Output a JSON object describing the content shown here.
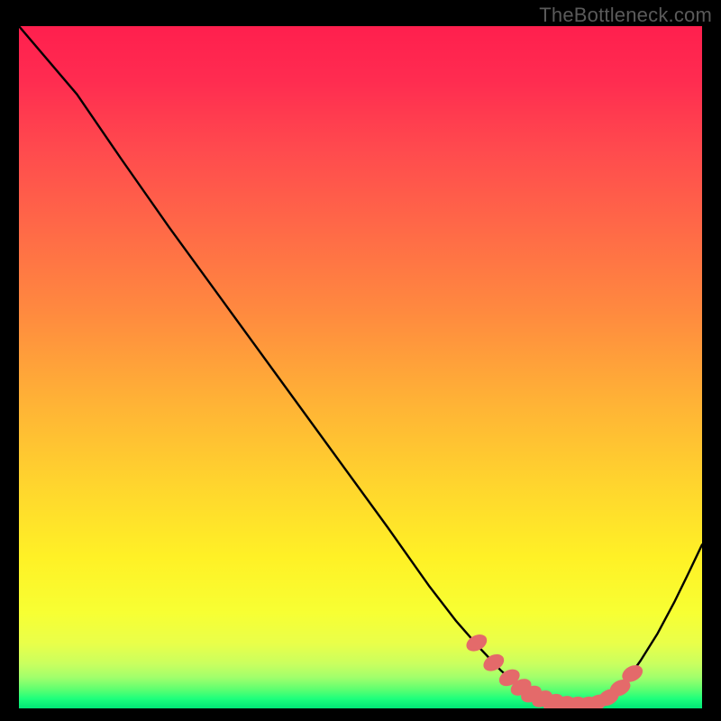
{
  "watermark": "TheBottleneck.com",
  "colors": {
    "frame": "#000000",
    "curve": "#000000",
    "marker_fill": "#e46a6a",
    "gradient_stops": [
      {
        "offset": 0.0,
        "color": "#ff1f4e"
      },
      {
        "offset": 0.08,
        "color": "#ff2c50"
      },
      {
        "offset": 0.18,
        "color": "#ff4a4e"
      },
      {
        "offset": 0.3,
        "color": "#ff6a47"
      },
      {
        "offset": 0.42,
        "color": "#ff8a3f"
      },
      {
        "offset": 0.55,
        "color": "#ffb236"
      },
      {
        "offset": 0.68,
        "color": "#ffd72d"
      },
      {
        "offset": 0.78,
        "color": "#fff126"
      },
      {
        "offset": 0.86,
        "color": "#f7ff33"
      },
      {
        "offset": 0.905,
        "color": "#e9ff4a"
      },
      {
        "offset": 0.935,
        "color": "#c9ff5f"
      },
      {
        "offset": 0.955,
        "color": "#a0ff6c"
      },
      {
        "offset": 0.972,
        "color": "#5fff70"
      },
      {
        "offset": 0.986,
        "color": "#1dff7c"
      },
      {
        "offset": 1.0,
        "color": "#00e676"
      }
    ]
  },
  "chart_data": {
    "type": "line",
    "title": "",
    "xlabel": "",
    "ylabel": "",
    "xlim": [
      0,
      100
    ],
    "ylim": [
      0,
      100
    ],
    "series": [
      {
        "name": "bottleneck-curve",
        "x": [
          0,
          8.5,
          15,
          22,
          30,
          38,
          46,
          54,
          60,
          64,
          67.5,
          70.5,
          73,
          76,
          79,
          82,
          84.5,
          87,
          89,
          91,
          93.5,
          96,
          98,
          100
        ],
        "values": [
          100,
          90,
          80.5,
          70.5,
          59.5,
          48.5,
          37.5,
          26.5,
          18,
          12.8,
          8.8,
          5.6,
          3.4,
          1.7,
          0.7,
          0.4,
          0.8,
          2.1,
          4.2,
          7.0,
          11.0,
          15.7,
          19.8,
          24
        ]
      }
    ],
    "markers": {
      "name": "highlight-dots",
      "x": [
        67.0,
        69.5,
        71.8,
        73.5,
        75.0,
        76.6,
        78.2,
        79.8,
        81.4,
        83.0,
        84.6,
        86.3,
        88.0,
        89.8
      ],
      "values": [
        9.6,
        6.7,
        4.5,
        3.1,
        2.1,
        1.4,
        0.9,
        0.6,
        0.5,
        0.5,
        0.8,
        1.6,
        3.0,
        5.1
      ],
      "rx": 1.6,
      "ry": 1.1,
      "rot": -28
    }
  }
}
